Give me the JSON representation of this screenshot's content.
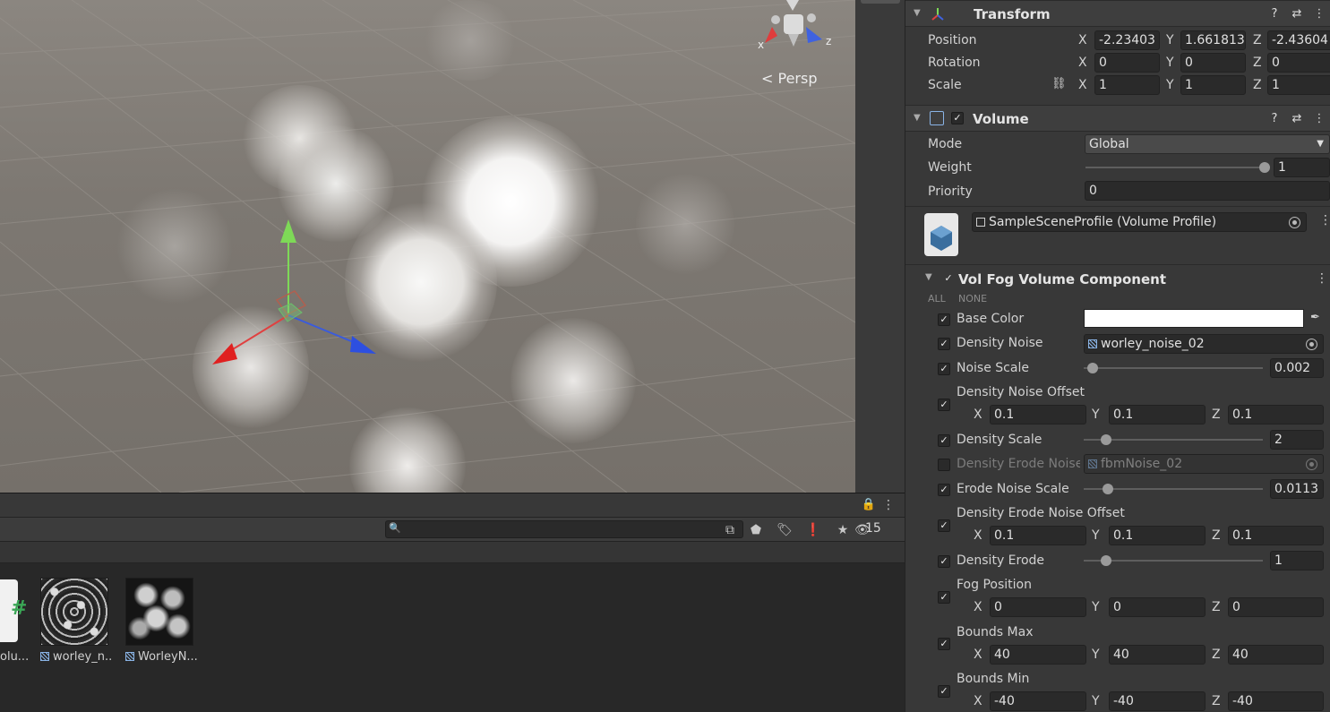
{
  "scene": {
    "view_label": "< Persp",
    "gizmo_axes": {
      "x": "x",
      "z": "z"
    }
  },
  "project": {
    "search_placeholder": "",
    "hidden_count": "15",
    "assets": [
      {
        "name": "olu..."
      },
      {
        "name": "worley_n..."
      },
      {
        "name": "WorleyN..."
      }
    ]
  },
  "inspector": {
    "transform": {
      "title": "Transform",
      "rows": [
        {
          "label": "Position",
          "x": "-2.23403",
          "y": "1.661813",
          "z": "-2.43604"
        },
        {
          "label": "Rotation",
          "x": "0",
          "y": "0",
          "z": "0"
        },
        {
          "label": "Scale",
          "x": "1",
          "y": "1",
          "z": "1"
        }
      ]
    },
    "volume": {
      "title": "Volume",
      "mode_label": "Mode",
      "mode_value": "Global",
      "weight_label": "Weight",
      "weight_value": "1",
      "weight_level": 1.0,
      "priority_label": "Priority",
      "priority_value": "0",
      "profile": "SampleSceneProfile (Volume Profile)"
    },
    "fog": {
      "title": "Vol Fog Volume Component",
      "all": "ALL",
      "none": "NONE",
      "base_color_label": "Base Color",
      "base_color": "#ffffff",
      "density_noise_label": "Density Noise",
      "density_noise_value": "worley_noise_02",
      "noise_scale_label": "Noise Scale",
      "noise_scale_value": "0.002",
      "density_noise_offset_label": "Density Noise Offset",
      "density_noise_offset": {
        "x": "0.1",
        "y": "0.1",
        "z": "0.1"
      },
      "density_scale_label": "Density Scale",
      "density_scale_value": "2",
      "density_erode_noise_label": "Density Erode Noise",
      "density_erode_noise_value": "fbmNoise_02",
      "erode_noise_scale_label": "Erode Noise Scale",
      "erode_noise_scale_value": "0.0113",
      "density_erode_noise_offset_label": "Density Erode Noise Offset",
      "density_erode_noise_offset": {
        "x": "0.1",
        "y": "0.1",
        "z": "0.1"
      },
      "density_erode_label": "Density Erode",
      "density_erode_value": "1",
      "fog_position_label": "Fog Position",
      "fog_position": {
        "x": "0",
        "y": "0",
        "z": "0"
      },
      "bounds_max_label": "Bounds Max",
      "bounds_max": {
        "x": "40",
        "y": "40",
        "z": "40"
      },
      "bounds_min_label": "Bounds Min",
      "bounds_min": {
        "x": "-40",
        "y": "-40",
        "z": "-40"
      }
    }
  }
}
